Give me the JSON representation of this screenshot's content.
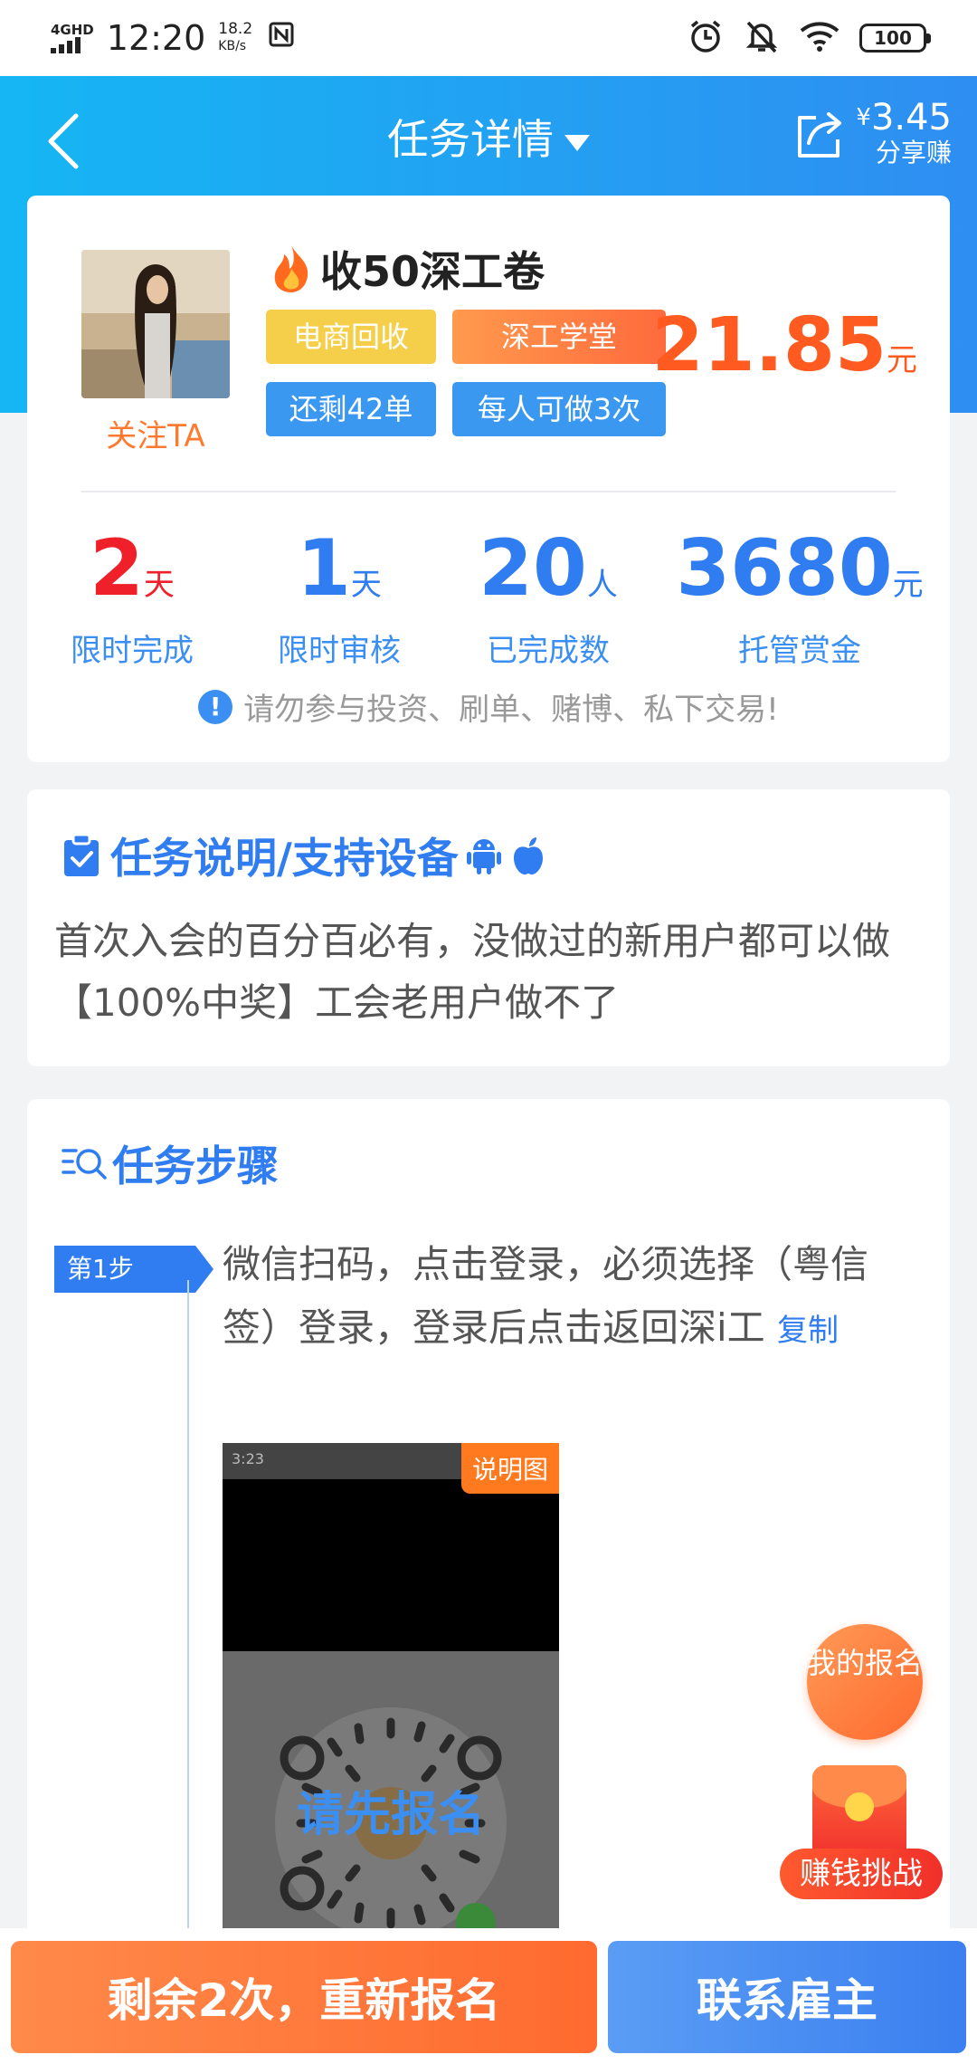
{
  "status_bar": {
    "network": "4GHD",
    "time": "12:20",
    "speed_value": "18.2",
    "speed_unit": "KB/s",
    "battery": "100"
  },
  "header": {
    "title": "任务详情",
    "share_currency": "¥",
    "share_amount": "3.45",
    "share_label": "分享赚",
    "gradient_start": "#15b6f3",
    "gradient_end": "#2f8ef2"
  },
  "task": {
    "title": "收50深工卷",
    "follow_label": "关注TA",
    "tags": [
      "电商回收",
      "深工学堂",
      "还剩42单",
      "每人可做3次"
    ],
    "price_value": "21.85",
    "price_unit": "元"
  },
  "stats": [
    {
      "value": "2",
      "unit": "天",
      "label": "限时完成"
    },
    {
      "value": "1",
      "unit": "天",
      "label": "限时审核"
    },
    {
      "value": "20",
      "unit": "人",
      "label": "已完成数"
    },
    {
      "value": "3680",
      "unit": "元",
      "label": "托管赏金"
    }
  ],
  "warning": "请勿参与投资、刷单、赌博、私下交易!",
  "description": {
    "title": "任务说明/支持设备",
    "text": "首次入会的百分百必有，没做过的新用户都可以做【100%中奖】工会老用户做不了"
  },
  "steps": {
    "title": "任务步骤",
    "items": [
      {
        "badge": "第1步",
        "text": "微信扫码，点击登录，必须选择（粤信签）登录，登录后点击返回深i工",
        "copy_label": "复制",
        "image_tag": "说明图",
        "image_overlay": "请先报名",
        "image_time": "3:23"
      }
    ]
  },
  "floating": {
    "my_signup": "我的报名",
    "challenge": "赚钱挑战"
  },
  "bottom": {
    "reapply": "剩余2次，重新报名",
    "contact": "联系雇主"
  },
  "colors": {
    "accent_blue": "#2f7df0",
    "accent_orange": "#ff6a2f",
    "price_red": "#ff5a1f"
  }
}
